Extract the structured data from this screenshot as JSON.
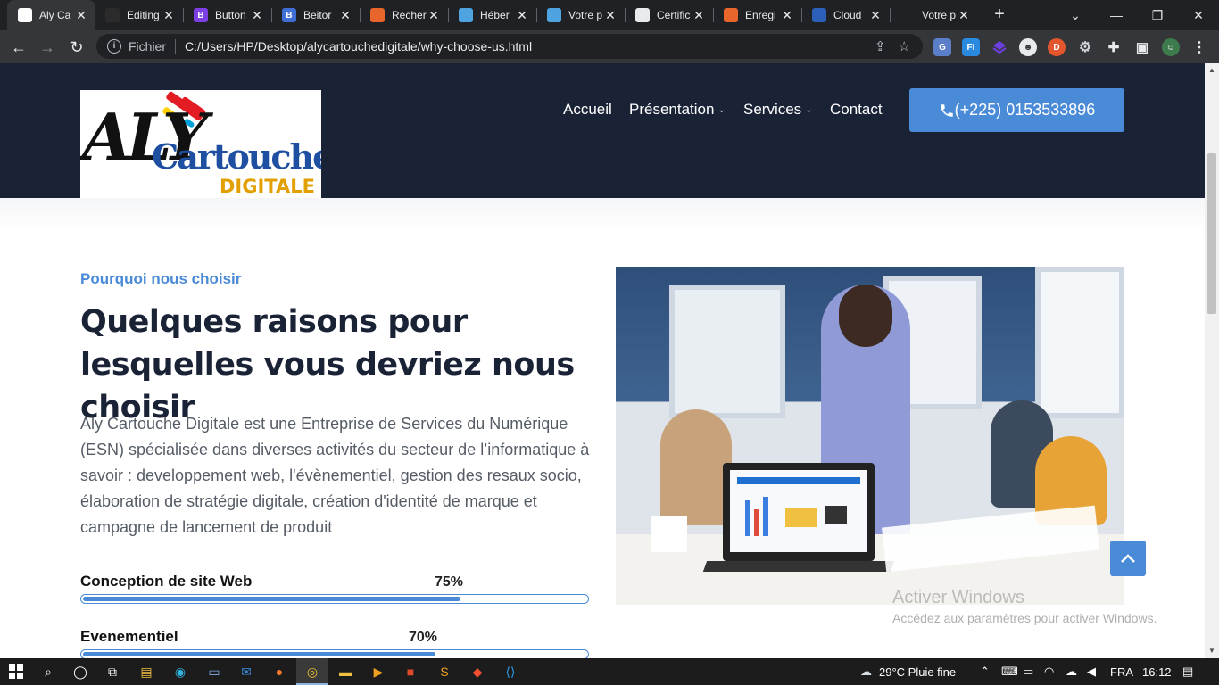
{
  "browser": {
    "tabs": [
      {
        "title": "Aly Ca",
        "color": "#ffffff",
        "active": true
      },
      {
        "title": "Editing",
        "color": "#2b2b2b"
      },
      {
        "title": "Button",
        "color": "#7b3fe4",
        "glyph": "B"
      },
      {
        "title": "Beitor",
        "color": "#3f6fd6",
        "glyph": "B"
      },
      {
        "title": "Recher",
        "color": "#e8652b"
      },
      {
        "title": "Héber",
        "color": "#4fa3e0"
      },
      {
        "title": "Votre p",
        "color": "#4fa3e0"
      },
      {
        "title": "Certific",
        "color": "#e8eaed"
      },
      {
        "title": "Enregi",
        "color": "#e8652b"
      },
      {
        "title": "Cloud",
        "color": "#2c5fb8"
      },
      {
        "title": "Votre p",
        "color": "#202124"
      }
    ],
    "address": {
      "scheme_label": "Fichier",
      "url": "C:/Users/HP/Desktop/alycartouchedigitale/why-choose-us.html"
    }
  },
  "site": {
    "logo": {
      "aly": "ALY",
      "cartouche": "Cartouche",
      "digitale": "DIGITALE"
    },
    "nav": [
      {
        "label": "Accueil",
        "dropdown": false
      },
      {
        "label": "Présentation",
        "dropdown": true
      },
      {
        "label": "Services",
        "dropdown": true
      },
      {
        "label": "Contact",
        "dropdown": false
      }
    ],
    "phone": "(+225) 0153533896",
    "accent_color": "#4a8bd8",
    "header_color": "#1a2236"
  },
  "content": {
    "eyebrow": "Pourquoi nous choisir",
    "headline": "Quelques raisons pour lesquelles vous devriez nous choisir",
    "paragraph": "Aly Cartouche Digitale est une Entreprise de Services du Numérique (ESN) spécialisée dans diverses activités du secteur de l’informatique à savoir : developpement web, l'évènementiel, gestion des resaux socio, élaboration de stratégie digitale, création d'identité de marque et campagne de lancement de produit",
    "skills": [
      {
        "name": "Conception de site Web",
        "percent_label": "75%",
        "value": 75
      },
      {
        "name": "Evenementiel",
        "percent_label": "70%",
        "value": 70
      }
    ]
  },
  "windows": {
    "watermark_title": "Activer Windows",
    "watermark_sub": "Accédez aux paramètres pour activer Windows.",
    "weather": "29°C  Pluie fine",
    "lang": "FRA",
    "time": "16:12"
  }
}
